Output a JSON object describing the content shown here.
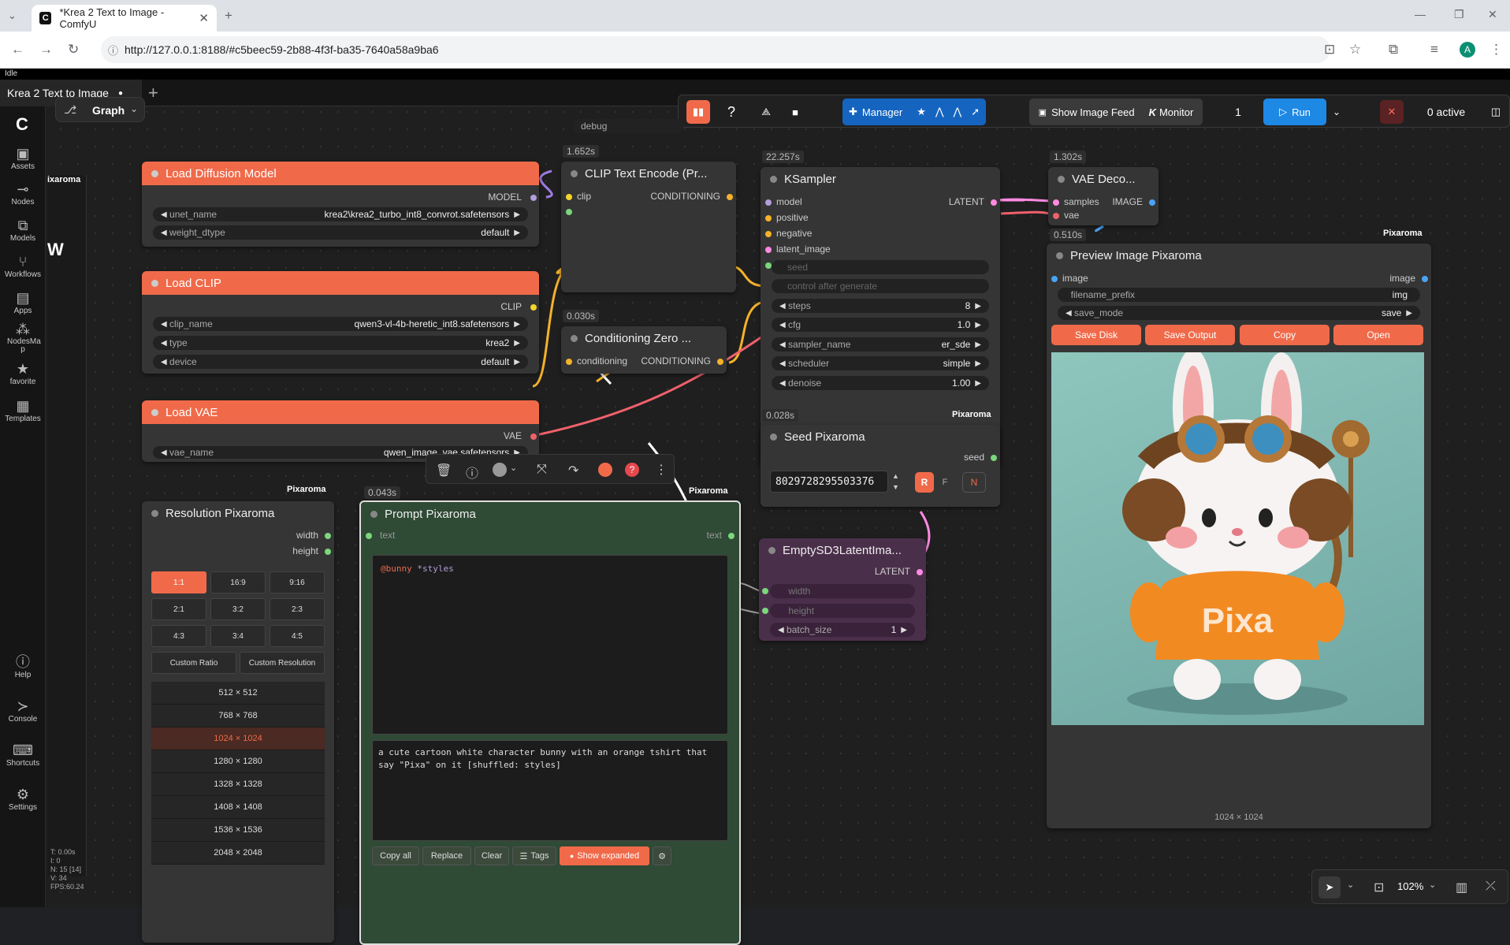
{
  "browser": {
    "tab_title": "*Krea 2 Text to Image - ComfyU",
    "url": "http://127.0.0.1:8188/#c5beec59-2b88-4f3f-ba35-7640a58a9ba6",
    "profile_initial": "A"
  },
  "app": {
    "status": "Idle",
    "workflow_tab": "Krea 2 Text to Image",
    "graph_label": "Graph",
    "sidebar": [
      {
        "label": "Assets"
      },
      {
        "label": "Nodes"
      },
      {
        "label": "Models"
      },
      {
        "label": "Workflows"
      },
      {
        "label": "Apps"
      },
      {
        "label": "NodesMa p"
      },
      {
        "label": "favorite"
      },
      {
        "label": "Templates"
      },
      {
        "label": "Help"
      },
      {
        "label": "Console"
      },
      {
        "label": "Shortcuts"
      },
      {
        "label": "Settings"
      }
    ],
    "stats": [
      "T: 0.00s",
      "I: 0",
      "N: 15 [14]",
      "V: 34",
      "FPS:60.24"
    ],
    "partial_label": "ixaroma",
    "partial_text": "W",
    "toolbar": {
      "manager": "Manager",
      "show_feed": "Show Image Feed",
      "monitor": "Monitor",
      "queue_count": "1",
      "run": "Run",
      "active": "0 active"
    },
    "zoom": "102%"
  },
  "nodes": {
    "debug_widget": "debug",
    "load_diffusion": {
      "title": "Load Diffusion Model",
      "output": "MODEL",
      "unet_label": "unet_name",
      "unet_value": "krea2\\krea2_turbo_int8_convrot.safetensors",
      "dtype_label": "weight_dtype",
      "dtype_value": "default"
    },
    "load_clip": {
      "title": "Load CLIP",
      "output": "CLIP",
      "clip_label": "clip_name",
      "clip_value": "qwen3-vl-4b-heretic_int8.safetensors",
      "type_label": "type",
      "type_value": "krea2",
      "device_label": "device",
      "device_value": "default"
    },
    "load_vae": {
      "title": "Load VAE",
      "output": "VAE",
      "vae_label": "vae_name",
      "vae_value": "qwen_image_vae.safetensors"
    },
    "clip_encode": {
      "time": "1.652s",
      "title": "CLIP Text Encode (Pr...",
      "input": "clip",
      "output": "CONDITIONING"
    },
    "cond_zero": {
      "time": "0.030s",
      "title": "Conditioning Zero ...",
      "input": "conditioning",
      "output": "CONDITIONING"
    },
    "ksampler": {
      "time": "22.257s",
      "title": "KSampler",
      "inputs": [
        "model",
        "positive",
        "negative",
        "latent_image"
      ],
      "output": "LATENT",
      "seed": "seed",
      "control": "control after generate",
      "widgets": [
        {
          "label": "steps",
          "value": "8"
        },
        {
          "label": "cfg",
          "value": "1.0"
        },
        {
          "label": "sampler_name",
          "value": "er_sde"
        },
        {
          "label": "scheduler",
          "value": "simple"
        },
        {
          "label": "denoise",
          "value": "1.00"
        }
      ]
    },
    "vae_decode": {
      "time": "1.302s",
      "title": "VAE Deco...",
      "inputs": [
        "samples",
        "vae"
      ],
      "output": "IMAGE"
    },
    "preview": {
      "time": "0.510s",
      "brand": "Pixaroma",
      "title": "Preview Image Pixaroma",
      "input": "image",
      "output": "image",
      "prefix_label": "filename_prefix",
      "prefix_value": "img",
      "mode_label": "save_mode",
      "mode_value": "save",
      "buttons": [
        "Save Disk",
        "Save Output",
        "Copy",
        "Open"
      ],
      "caption": "1024 × 1024",
      "shirt_text": "Pixa"
    },
    "seed": {
      "time": "0.028s",
      "brand": "Pixaroma",
      "title": "Seed Pixaroma",
      "output": "seed",
      "value": "8029728295503376",
      "r": "R",
      "f": "F",
      "n": "N"
    },
    "empty_latent": {
      "title": "EmptySD3LatentIma...",
      "output": "LATENT",
      "w": "width",
      "h": "height",
      "batch_label": "batch_size",
      "batch_value": "1"
    },
    "resolution": {
      "brand": "Pixaroma",
      "title": "Resolution Pixaroma",
      "outputs": [
        "width",
        "height"
      ],
      "ratios": [
        "1:1",
        "16:9",
        "9:16",
        "2:1",
        "3:2",
        "2:3",
        "4:3",
        "3:4",
        "4:5"
      ],
      "custom_ratio": "Custom Ratio",
      "custom_res": "Custom Resolution",
      "sizes": [
        "512 × 512",
        "768 × 768",
        "1024 × 1024",
        "1280 × 1280",
        "1328 × 1328",
        "1408 × 1408",
        "1536 × 1536",
        "2048 × 2048"
      ]
    },
    "prompt": {
      "time": "0.043s",
      "brand": "Pixaroma",
      "title": "Prompt Pixaroma",
      "input": "text",
      "output": "text",
      "template_at": "@bunny",
      "template_star": "*styles",
      "text": "a cute cartoon white character bunny with an orange tshirt that say \"Pixa\" on it [shuffled: styles]",
      "buttons": [
        "Copy all",
        "Replace",
        "Clear",
        "Tags",
        "Show expanded"
      ]
    }
  },
  "colors": {
    "accent": "#f06a4a",
    "run": "#1e88e5",
    "manager": "#1565c0",
    "prompt_bg": "#2f4a35",
    "latent_bg": "#4a2f4a"
  }
}
